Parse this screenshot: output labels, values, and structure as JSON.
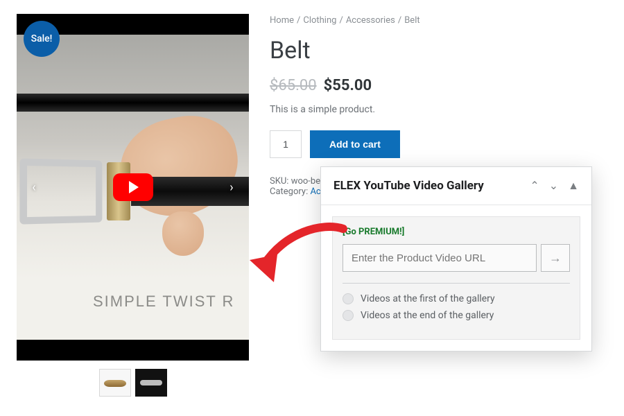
{
  "breadcrumbs": {
    "home": "Home",
    "clothing": "Clothing",
    "accessories": "Accessories",
    "belt": "Belt",
    "sep": "/"
  },
  "product": {
    "title": "Belt",
    "sale_badge": "Sale!",
    "old_price": "$65.00",
    "price": "$55.00",
    "tagline": "This is a simple product.",
    "qty": "1",
    "add_to_cart": "Add to cart",
    "sku_label": "SKU:",
    "sku_value": "woo-be",
    "category_label": "Category:",
    "category_value": "Ac",
    "video_caption": "SIMPLE TWIST R"
  },
  "metabox": {
    "title": "ELEX YouTube Video Gallery",
    "go_premium": "[Go PREMIUM!]",
    "url_placeholder": "Enter the Product Video URL",
    "submit_glyph": "→",
    "opt_first": "Videos at the first of the gallery",
    "opt_end": "Videos at the end of the gallery",
    "ctrl_up": "⌃",
    "ctrl_down": "⌄",
    "ctrl_collapse": "▲"
  },
  "nav": {
    "prev": "‹",
    "next": "›"
  }
}
